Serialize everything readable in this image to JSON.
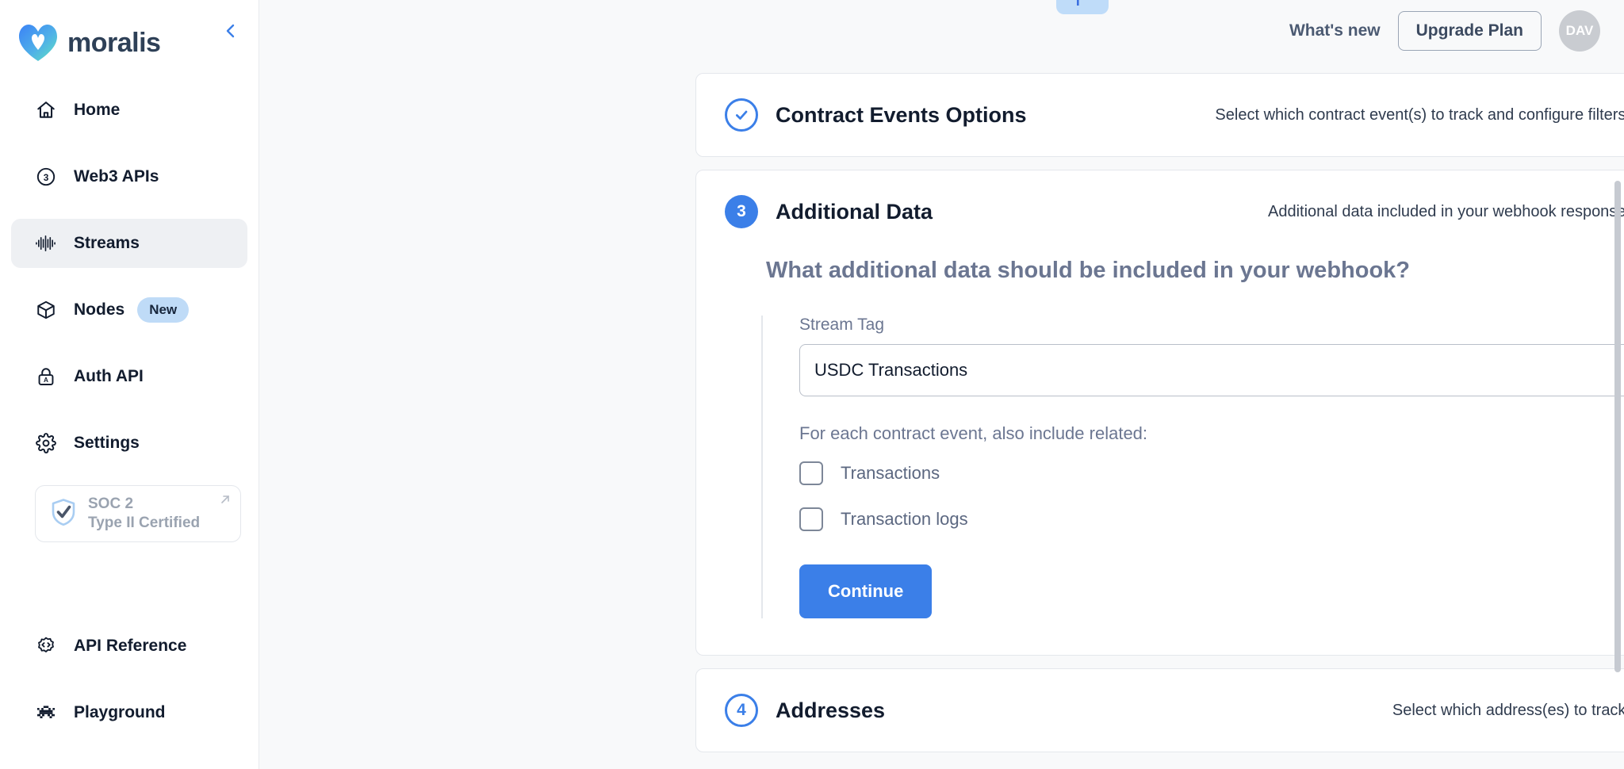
{
  "sidebar": {
    "brand": "moralis",
    "collapse_icon": "chevron-left-icon",
    "items": [
      {
        "label": "Home",
        "icon": "home-icon",
        "active": false
      },
      {
        "label": "Web3 APIs",
        "icon": "circle-three-icon",
        "active": false
      },
      {
        "label": "Streams",
        "icon": "waveform-icon",
        "active": true
      },
      {
        "label": "Nodes",
        "icon": "cube-icon",
        "active": false,
        "badge": "New"
      },
      {
        "label": "Auth API",
        "icon": "lock-icon",
        "active": false
      },
      {
        "label": "Settings",
        "icon": "gear-icon",
        "active": false
      }
    ],
    "soc_badge": {
      "line1": "SOC 2",
      "line2": "Type II Certified",
      "icon": "shield-check-icon",
      "external_icon": "external-link-icon"
    },
    "bottom_items": [
      {
        "label": "API Reference",
        "icon": "code-badge-icon"
      },
      {
        "label": "Playground",
        "icon": "alien-icon"
      }
    ]
  },
  "topbar": {
    "whats_new": "What's new",
    "upgrade_plan": "Upgrade Plan",
    "avatar_initials": "DAV",
    "flag_icon": "flag-icon"
  },
  "cards": [
    {
      "step": "check",
      "step_icon": "circle-check-icon",
      "title": "Contract Events Options",
      "description": "Select which contract event(s) to track and configure filters.",
      "chevron": "chevron-down-icon",
      "expanded": false
    },
    {
      "step": "3",
      "title": "Additional Data",
      "description": "Additional data included in your webhook response.",
      "chevron": "chevron-up-icon",
      "expanded": true,
      "body": {
        "heading": "What additional data should be included in your webhook?",
        "stream_tag_label": "Stream Tag",
        "stream_tag_value": "USDC Transactions",
        "stream_tag_placeholder": "Stream Tag",
        "include_label": "For each contract event, also include related:",
        "checkboxes": [
          {
            "label": "Transactions",
            "checked": false
          },
          {
            "label": "Transaction logs",
            "checked": false
          }
        ],
        "continue_label": "Continue"
      }
    },
    {
      "step": "4",
      "title": "Addresses",
      "description": "Select which address(es) to track.",
      "chevron": "chevron-down-icon",
      "expanded": false
    }
  ],
  "colors": {
    "accent_blue": "#3b7fe8",
    "badge_blue": "#bfdbf7",
    "text_dark": "#121c2e",
    "text_muted": "#6b7691",
    "sidebar_active": "#eef0f3"
  }
}
